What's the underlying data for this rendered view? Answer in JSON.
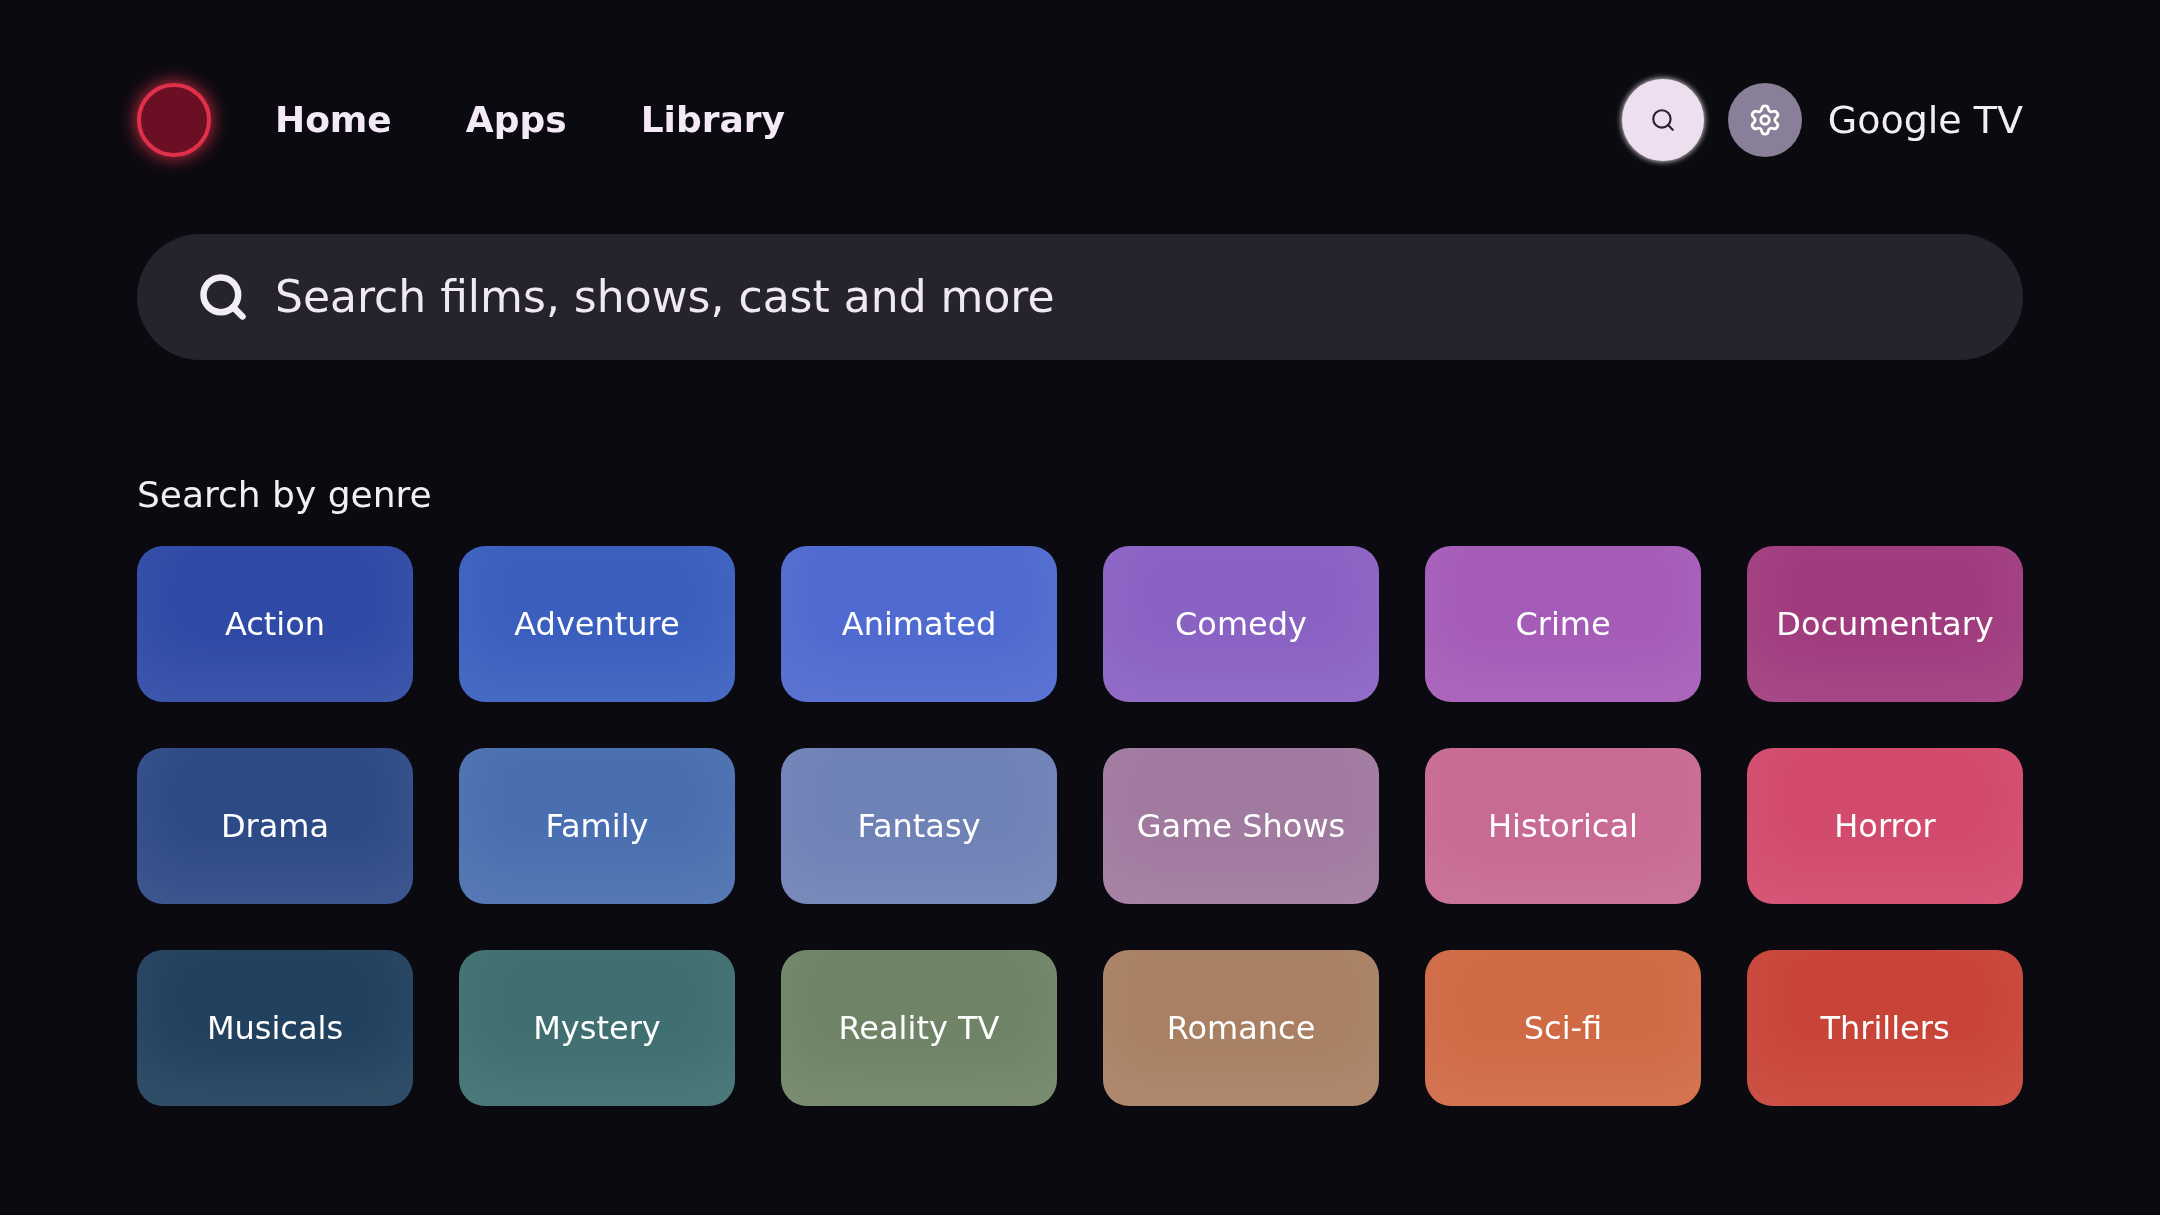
{
  "nav": [
    {
      "label": "Home",
      "selected": false
    },
    {
      "label": "Apps",
      "selected": false
    },
    {
      "label": "Library",
      "selected": false
    }
  ],
  "search_button": {
    "selected": true
  },
  "settings_button": {
    "selected": false
  },
  "brand": "Google TV",
  "search": {
    "placeholder": "Search films, shows, cast and more"
  },
  "section_title": "Search by genre",
  "genres": [
    {
      "label": "Action",
      "color": "#2f4aa6"
    },
    {
      "label": "Adventure",
      "color": "#3a5fbf"
    },
    {
      "label": "Animated",
      "color": "#4f6ad0"
    },
    {
      "label": "Comedy",
      "color": "#8a62c4"
    },
    {
      "label": "Crime",
      "color": "#a55cb8"
    },
    {
      "label": "Documentary",
      "color": "#a03c7e"
    },
    {
      "label": "Drama",
      "color": "#2e4a86"
    },
    {
      "label": "Family",
      "color": "#4a6fb0"
    },
    {
      "label": "Fantasy",
      "color": "#6f82b6"
    },
    {
      "label": "Game Shows",
      "color": "#a07a9f"
    },
    {
      "label": "Historical",
      "color": "#c76a94"
    },
    {
      "label": "Horror",
      "color": "#d24a6c"
    },
    {
      "label": "Musicals",
      "color": "#22415e"
    },
    {
      "label": "Mystery",
      "color": "#3f6f70"
    },
    {
      "label": "Reality TV",
      "color": "#6f8466"
    },
    {
      "label": "Romance",
      "color": "#a98064"
    },
    {
      "label": "Sci-fi",
      "color": "#d06a44"
    },
    {
      "label": "Thrillers",
      "color": "#c94438"
    }
  ]
}
